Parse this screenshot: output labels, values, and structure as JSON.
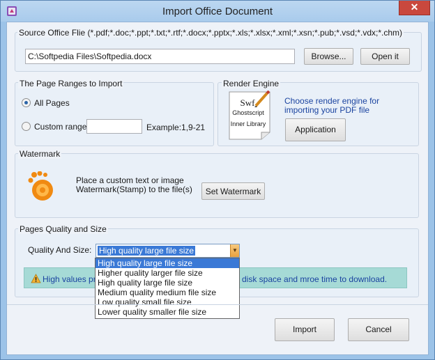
{
  "window": {
    "title": "Import Office Document",
    "close_glyph": "✕"
  },
  "source": {
    "group_title": "Source Office Flie (*.pdf;*.doc;*.ppt;*.txt;*.rtf;*.docx;*.pptx;*.xls;*.xlsx;*.xml;*.xsn;*.pub;*.vsd;*.vdx;*.chm)",
    "path": "C:\\Softpedia Files\\Softpedia.docx",
    "browse_label": "Browse...",
    "open_label": "Open it"
  },
  "ranges": {
    "group_title": "The Page Ranges to Import",
    "all_pages_label": "All Pages",
    "all_pages_selected": true,
    "custom_label": "Custom range:",
    "custom_selected": false,
    "custom_value": "",
    "example": "Example:1,9-21"
  },
  "render": {
    "group_title": "Render Engine",
    "card_line1": "Swf",
    "card_line2": "Ghostscript",
    "card_line3": "Inner Library",
    "description_line1": "Choose render engine for",
    "description_line2": "importing your PDF file",
    "application_label": "Application"
  },
  "watermark": {
    "group_title": "Watermark",
    "description_line1": "Place a custom text or image",
    "description_line2": "Watermark(Stamp) to the file(s)",
    "button_label": "Set Watermark"
  },
  "quality": {
    "group_title": "Pages Quality and Size",
    "label": "Quality And Size:",
    "selected": "High quality large file size",
    "options": [
      "High quality large file size",
      "Higher quality larger file size",
      "High quality large file size",
      "Medium quality medium file size",
      "Low quality small file size",
      "Lower quality smaller file size"
    ],
    "warning_left": "High values pro",
    "warning_right": "disk space and mroe time to download."
  },
  "actions": {
    "import_label": "Import",
    "cancel_label": "Cancel"
  }
}
